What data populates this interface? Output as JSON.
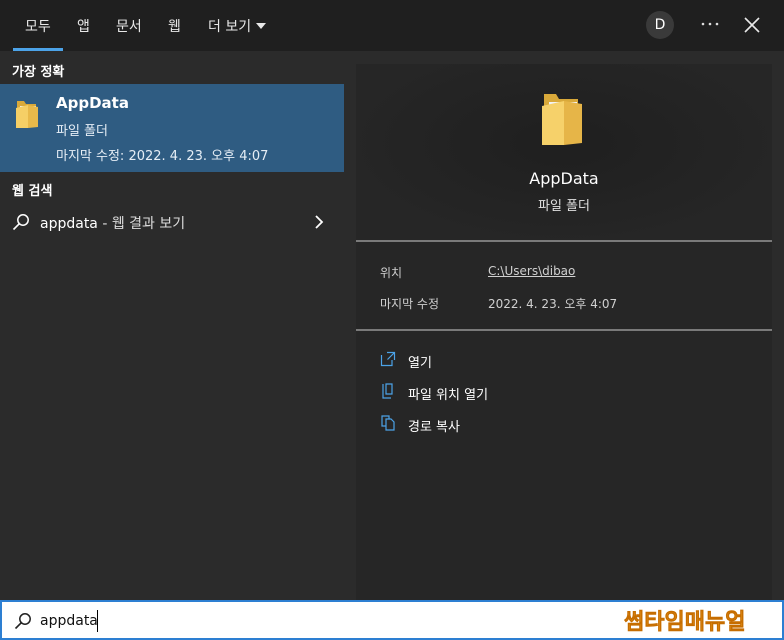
{
  "tabs": [
    {
      "label": "모두",
      "active": true
    },
    {
      "label": "앱"
    },
    {
      "label": "문서"
    },
    {
      "label": "웹"
    },
    {
      "label": "더 보기"
    }
  ],
  "account": {
    "initial": "D"
  },
  "icons": {
    "more": "more-horizontal-icon",
    "close": "close-icon",
    "folder": "folder-icon",
    "search": "search-icon"
  },
  "left": {
    "best_match_label": "가장 정확",
    "best_match": {
      "title": "AppData",
      "type": "파일 폴더",
      "modified": "마지막 수정: 2022. 4. 23. 오후 4:07"
    },
    "web_search_label": "웹 검색",
    "web_result": {
      "query": "appdata",
      "suffix": " - 웹 결과 보기"
    }
  },
  "preview": {
    "title": "AppData",
    "type": "파일 폴더",
    "location_label": "위치",
    "location_value": "C:\\Users\\dibao",
    "modified_label": "마지막 수정",
    "modified_value": "2022. 4. 23. 오후 4:07",
    "actions": [
      {
        "label": "열기",
        "icon": "open-icon"
      },
      {
        "label": "파일 위치 열기",
        "icon": "file-location-icon"
      },
      {
        "label": "경로 복사",
        "icon": "copy-path-icon"
      }
    ]
  },
  "search": {
    "value": "appdata"
  },
  "watermark": "썸타임매뉴얼",
  "colors": {
    "accent": "#4ca3e8",
    "selected": "#2f5c82",
    "search_border": "#2d7fd2",
    "watermark": "#f0a020"
  }
}
